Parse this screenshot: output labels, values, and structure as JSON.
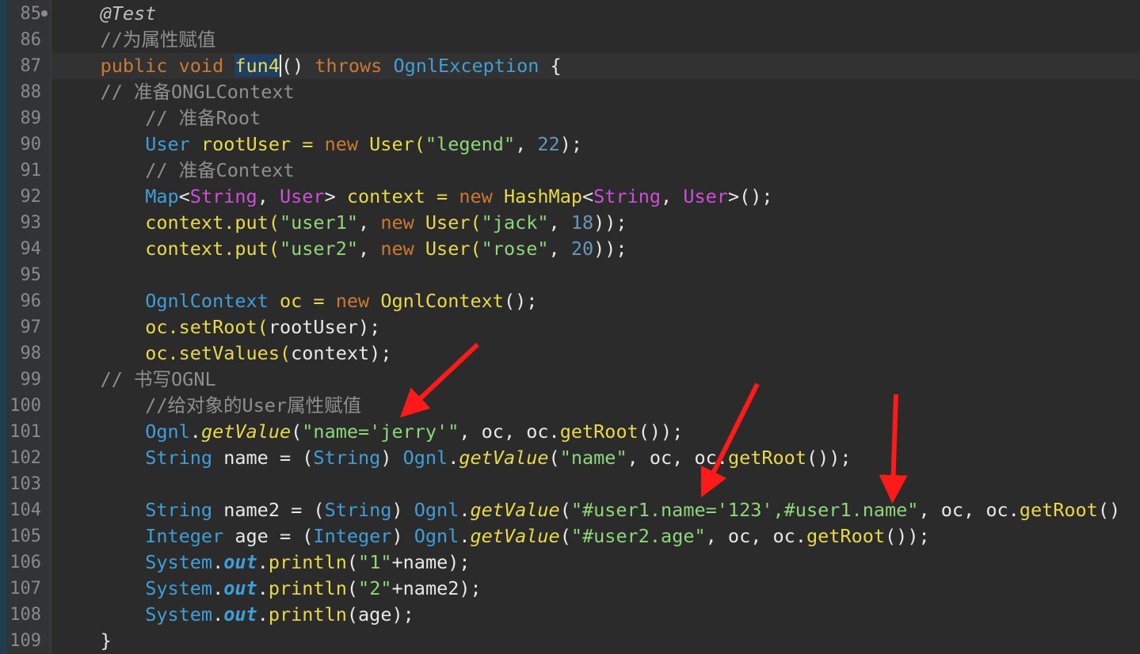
{
  "editor": {
    "lines": [
      {
        "n": "85",
        "fold": true,
        "parts": [
          [
            "    ",
            ""
          ],
          [
            "@Test",
            "ann"
          ]
        ]
      },
      {
        "n": "86",
        "parts": [
          [
            "    ",
            ""
          ],
          [
            "//为属性赋值",
            "cm"
          ]
        ]
      },
      {
        "n": "87",
        "current": true,
        "parts": [
          [
            "    ",
            ""
          ],
          [
            "public void ",
            "kw"
          ],
          [
            "fun4",
            "sel"
          ],
          [
            "()",
            ""
          ],
          [
            " throws ",
            "kw"
          ],
          [
            "OgnlException",
            "tyb"
          ],
          [
            " {",
            ""
          ]
        ]
      },
      {
        "n": "88",
        "parts": [
          [
            "    ",
            ""
          ],
          [
            "// 准备ONGLContext",
            "cm"
          ]
        ]
      },
      {
        "n": "89",
        "parts": [
          [
            "        ",
            ""
          ],
          [
            "// 准备Root",
            "cm"
          ]
        ]
      },
      {
        "n": "90",
        "parts": [
          [
            "        ",
            ""
          ],
          [
            "User",
            "tyb"
          ],
          [
            " rootUser = ",
            "fn"
          ],
          [
            "new ",
            "kw"
          ],
          [
            "User(",
            "fn"
          ],
          [
            "\"legend\"",
            "str"
          ],
          [
            ", ",
            ""
          ],
          [
            "22",
            "num"
          ],
          [
            ");",
            ""
          ]
        ]
      },
      {
        "n": "91",
        "parts": [
          [
            "        ",
            ""
          ],
          [
            "// 准备Context",
            "cm"
          ]
        ]
      },
      {
        "n": "92",
        "parts": [
          [
            "        ",
            ""
          ],
          [
            "Map",
            "tyb"
          ],
          [
            "<",
            ""
          ],
          [
            "String",
            "mg"
          ],
          [
            ", ",
            ""
          ],
          [
            "User",
            "mg"
          ],
          [
            "> ",
            ""
          ],
          [
            "context = ",
            "fn"
          ],
          [
            "new ",
            "kw"
          ],
          [
            "HashMap",
            "fn"
          ],
          [
            "<",
            ""
          ],
          [
            "String",
            "mg"
          ],
          [
            ", ",
            ""
          ],
          [
            "User",
            "mg"
          ],
          [
            ">();",
            ""
          ]
        ]
      },
      {
        "n": "93",
        "parts": [
          [
            "        ",
            ""
          ],
          [
            "context.put(",
            "fn"
          ],
          [
            "\"user1\"",
            "str"
          ],
          [
            ", ",
            ""
          ],
          [
            "new ",
            "kw"
          ],
          [
            "User(",
            "fn"
          ],
          [
            "\"jack\"",
            "str"
          ],
          [
            ", ",
            ""
          ],
          [
            "18",
            "num"
          ],
          [
            "));",
            ""
          ]
        ]
      },
      {
        "n": "94",
        "parts": [
          [
            "        ",
            ""
          ],
          [
            "context.put(",
            "fn"
          ],
          [
            "\"user2\"",
            "str"
          ],
          [
            ", ",
            ""
          ],
          [
            "new ",
            "kw"
          ],
          [
            "User(",
            "fn"
          ],
          [
            "\"rose\"",
            "str"
          ],
          [
            ", ",
            ""
          ],
          [
            "20",
            "num"
          ],
          [
            "));",
            ""
          ]
        ]
      },
      {
        "n": "95",
        "parts": []
      },
      {
        "n": "96",
        "parts": [
          [
            "        ",
            ""
          ],
          [
            "OgnlContext",
            "tyb"
          ],
          [
            " oc = ",
            "fn"
          ],
          [
            "new ",
            "kw"
          ],
          [
            "OgnlContext",
            "fn"
          ],
          [
            "();",
            ""
          ]
        ]
      },
      {
        "n": "97",
        "parts": [
          [
            "        ",
            ""
          ],
          [
            "oc.setRoot(",
            "fn"
          ],
          [
            "rootUser",
            ""
          ],
          [
            ");",
            ""
          ]
        ]
      },
      {
        "n": "98",
        "parts": [
          [
            "        ",
            ""
          ],
          [
            "oc.setValues(",
            "fn"
          ],
          [
            "context",
            ""
          ],
          [
            ");",
            ""
          ]
        ]
      },
      {
        "n": "99",
        "parts": [
          [
            "    ",
            ""
          ],
          [
            "// 书写OGNL",
            "cm"
          ]
        ]
      },
      {
        "n": "100",
        "parts": [
          [
            "        ",
            ""
          ],
          [
            "//给对象的User属性赋值",
            "cm"
          ]
        ]
      },
      {
        "n": "101",
        "parts": [
          [
            "        ",
            ""
          ],
          [
            "Ognl",
            "tyb"
          ],
          [
            ".",
            ""
          ],
          [
            "getValue",
            "it fn"
          ],
          [
            "(",
            ""
          ],
          [
            "\"name='jerry'\"",
            "str"
          ],
          [
            ", oc, oc.",
            ""
          ],
          [
            "getRoot",
            "fn"
          ],
          [
            "());",
            ""
          ]
        ]
      },
      {
        "n": "102",
        "parts": [
          [
            "        ",
            ""
          ],
          [
            "String",
            "tyb"
          ],
          [
            " name = (",
            ""
          ],
          [
            "String",
            "tyb"
          ],
          [
            ") ",
            ""
          ],
          [
            "Ognl",
            "tyb"
          ],
          [
            ".",
            ""
          ],
          [
            "getValue",
            "it fn"
          ],
          [
            "(",
            ""
          ],
          [
            "\"name\"",
            "str"
          ],
          [
            ", oc, oc.",
            ""
          ],
          [
            "getRoot",
            "fn"
          ],
          [
            "());",
            ""
          ]
        ]
      },
      {
        "n": "103",
        "parts": []
      },
      {
        "n": "104",
        "parts": [
          [
            "        ",
            ""
          ],
          [
            "String",
            "tyb"
          ],
          [
            " name2 = (",
            ""
          ],
          [
            "String",
            "tyb"
          ],
          [
            ") ",
            ""
          ],
          [
            "Ognl",
            "tyb"
          ],
          [
            ".",
            ""
          ],
          [
            "getValue",
            "it fn"
          ],
          [
            "(",
            ""
          ],
          [
            "\"#user1.name='123',#user1.name\"",
            "str"
          ],
          [
            ", oc, oc.",
            ""
          ],
          [
            "getRoot",
            "fn"
          ],
          [
            "()",
            ""
          ]
        ]
      },
      {
        "n": "105",
        "parts": [
          [
            "        ",
            ""
          ],
          [
            "Integer",
            "tyb"
          ],
          [
            " age = (",
            ""
          ],
          [
            "Integer",
            "tyb"
          ],
          [
            ") ",
            ""
          ],
          [
            "Ognl",
            "tyb"
          ],
          [
            ".",
            ""
          ],
          [
            "getValue",
            "it fn"
          ],
          [
            "(",
            ""
          ],
          [
            "\"#user2.age\"",
            "str"
          ],
          [
            ", oc, oc.",
            ""
          ],
          [
            "getRoot",
            "fn"
          ],
          [
            "());",
            ""
          ]
        ]
      },
      {
        "n": "106",
        "parts": [
          [
            "        ",
            ""
          ],
          [
            "System",
            "tyb"
          ],
          [
            ".",
            ""
          ],
          [
            "out",
            "itb tyb"
          ],
          [
            ".",
            ""
          ],
          [
            "println",
            "fn"
          ],
          [
            "(",
            ""
          ],
          [
            "\"1\"",
            "str"
          ],
          [
            "+name);",
            ""
          ]
        ]
      },
      {
        "n": "107",
        "parts": [
          [
            "        ",
            ""
          ],
          [
            "System",
            "tyb"
          ],
          [
            ".",
            ""
          ],
          [
            "out",
            "itb tyb"
          ],
          [
            ".",
            ""
          ],
          [
            "println",
            "fn"
          ],
          [
            "(",
            ""
          ],
          [
            "\"2\"",
            "str"
          ],
          [
            "+name2);",
            ""
          ]
        ]
      },
      {
        "n": "108",
        "parts": [
          [
            "        ",
            ""
          ],
          [
            "System",
            "tyb"
          ],
          [
            ".",
            ""
          ],
          [
            "out",
            "itb tyb"
          ],
          [
            ".",
            ""
          ],
          [
            "println",
            "fn"
          ],
          [
            "(age);",
            ""
          ]
        ]
      },
      {
        "n": "109",
        "parts": [
          [
            "    }",
            ""
          ]
        ]
      }
    ]
  },
  "colors": {
    "background": "#2b2b2b",
    "keyword": "#cc7832",
    "comment": "#8f8f8f",
    "type": "#3f9ed8",
    "string": "#8fd67a",
    "number": "#6897bb",
    "identifier": "#e8d94b",
    "generic_type": "#cd4fd6",
    "arrow": "#ff1a1a"
  },
  "annotations": {
    "arrow_count": 3
  }
}
